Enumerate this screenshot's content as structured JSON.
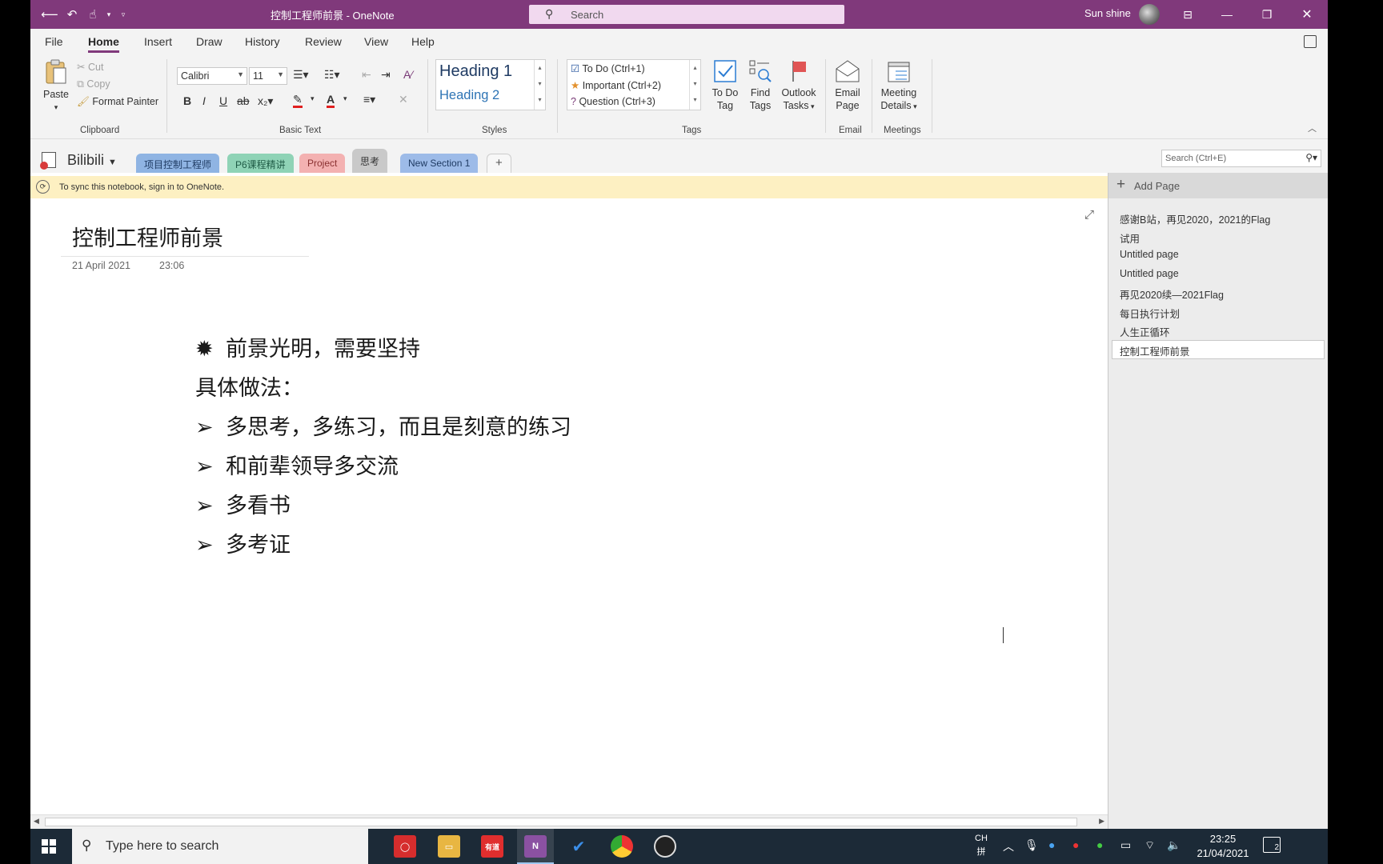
{
  "titlebar": {
    "document_title": "控制工程师前景 - OneNote",
    "search_placeholder": "Search",
    "user_name": "Sun shine"
  },
  "menu": {
    "tabs": [
      "File",
      "Home",
      "Insert",
      "Draw",
      "History",
      "Review",
      "View",
      "Help"
    ],
    "active": "Home"
  },
  "ribbon": {
    "clipboard": {
      "paste": "Paste",
      "cut": "Cut",
      "copy": "Copy",
      "format_painter": "Format Painter",
      "label": "Clipboard"
    },
    "basic_text": {
      "font": "Calibri",
      "size": "11",
      "label": "Basic Text"
    },
    "styles": {
      "heading1": "Heading 1",
      "heading2": "Heading 2",
      "label": "Styles"
    },
    "tags": {
      "todo": "To Do (Ctrl+1)",
      "important": "Important (Ctrl+2)",
      "question": "Question (Ctrl+3)",
      "label": "Tags"
    },
    "todo_tag": {
      "line1": "To Do",
      "line2": "Tag"
    },
    "find_tags": {
      "line1": "Find",
      "line2": "Tags"
    },
    "outlook_tasks": {
      "line1": "Outlook",
      "line2": "Tasks"
    },
    "email": {
      "line1": "Email",
      "line2": "Page",
      "label": "Email"
    },
    "meetings": {
      "line1": "Meeting",
      "line2": "Details",
      "label": "Meetings"
    }
  },
  "notebook": {
    "name": "Bilibili",
    "sections": [
      {
        "label": "项目控制工程师",
        "color": "#8fb4e3"
      },
      {
        "label": "P6课程精讲",
        "color": "#8fd3b6"
      },
      {
        "label": "Project",
        "color": "#f3b1b1"
      },
      {
        "label": "思考",
        "color": "#c9c9c9"
      },
      {
        "label": "New Section 1",
        "color": "#9dbbe8"
      }
    ],
    "add_section": "+",
    "search_placeholder": "Search (Ctrl+E)"
  },
  "sync_message": "To sync this notebook, sign in to OneNote.",
  "page": {
    "title": "控制工程师前景",
    "date": "21 April 2021",
    "time": "23:06",
    "lines": [
      {
        "bullet": "✹",
        "text": "前景光明，需要坚持"
      },
      {
        "bullet": "",
        "text": "具体做法："
      },
      {
        "bullet": "➢",
        "text": "多思考，多练习，而且是刻意的练习"
      },
      {
        "bullet": "➢",
        "text": "和前辈领导多交流"
      },
      {
        "bullet": "➢",
        "text": "多看书"
      },
      {
        "bullet": "➢",
        "text": "多考证"
      }
    ]
  },
  "pagelist": {
    "add_page": "Add Page",
    "pages": [
      "感谢B站，再见2020，2021的Flag",
      "试用",
      "Untitled page",
      "Untitled page",
      "再见2020续—2021Flag",
      "每日执行计划",
      "人生正循环",
      "控制工程师前景"
    ],
    "selected": "控制工程师前景"
  },
  "taskbar": {
    "search_placeholder": "Type here to search",
    "input_lang_top": "CH",
    "input_lang_bottom": "拼",
    "time": "23:25",
    "date": "21/04/2021",
    "notifications": "2"
  }
}
